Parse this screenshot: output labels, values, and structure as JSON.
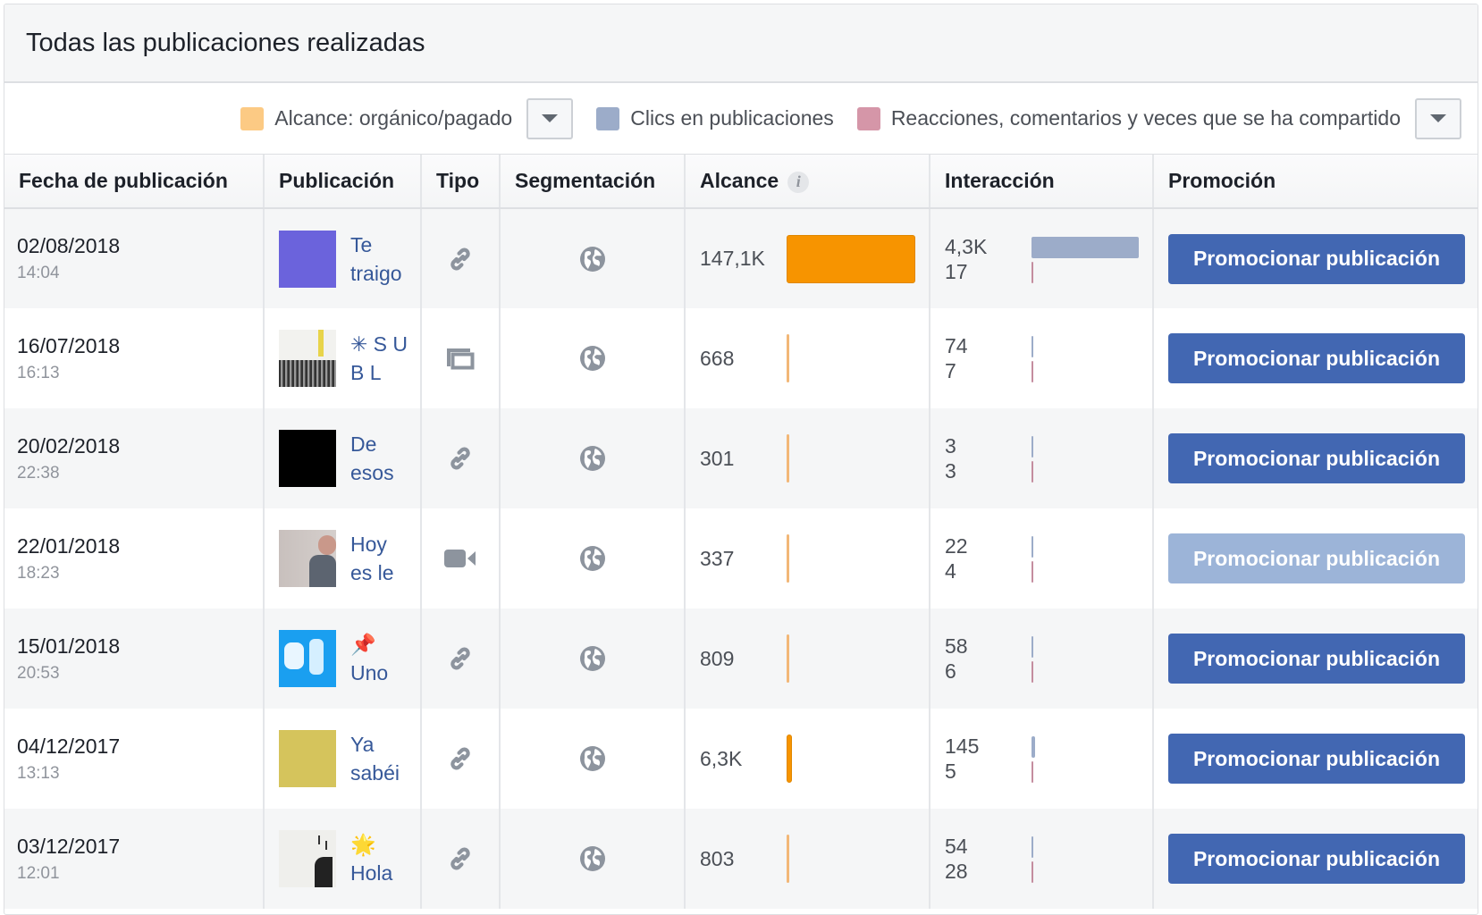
{
  "panel": {
    "title": "Todas las publicaciones realizadas"
  },
  "legend": {
    "items": [
      {
        "label": "Alcance: orgánico/pagado",
        "color": "#fcca84"
      },
      {
        "label": "Clics en publicaciones",
        "color": "#9cacc9"
      },
      {
        "label": "Reacciones, comentarios y veces que se ha compartido",
        "color": "#d596a8"
      }
    ]
  },
  "columns": {
    "date": "Fecha de publicación",
    "publication": "Publicación",
    "type": "Tipo",
    "targeting": "Segmentación",
    "reach": "Alcance",
    "reach_info_icon": "i",
    "interaction": "Interacción",
    "promotion": "Promoción"
  },
  "colors": {
    "reach_bar": "#f79400",
    "clicks_bar": "#9cacc9",
    "reactions_bar": "#c48d9f",
    "promo_button": "#4267b2",
    "promo_button_disabled": "#9cb4d8",
    "link_text": "#365899"
  },
  "rows": [
    {
      "date": "02/08/2018",
      "time": "14:04",
      "thumb": "purple",
      "text": "Te traigo",
      "type_icon": "link-icon",
      "targeting_icon": "globe-icon",
      "reach": "147,1K",
      "reach_value": 147100,
      "clicks": "4,3K",
      "clicks_value": 4300,
      "reactions": "17",
      "reactions_value": 17,
      "promo_label": "Promocionar publicación",
      "promo_enabled": true
    },
    {
      "date": "16/07/2018",
      "time": "16:13",
      "thumb": "crowd",
      "text": "✳ S U B L",
      "type_icon": "album-icon",
      "targeting_icon": "globe-icon",
      "reach": "668",
      "reach_value": 668,
      "clicks": "74",
      "clicks_value": 74,
      "reactions": "7",
      "reactions_value": 7,
      "promo_label": "Promocionar publicación",
      "promo_enabled": true
    },
    {
      "date": "20/02/2018",
      "time": "22:38",
      "thumb": "black",
      "text": "De esos",
      "type_icon": "link-icon",
      "targeting_icon": "globe-icon",
      "reach": "301",
      "reach_value": 301,
      "clicks": "3",
      "clicks_value": 3,
      "reactions": "3",
      "reactions_value": 3,
      "promo_label": "Promocionar publicación",
      "promo_enabled": true
    },
    {
      "date": "22/01/2018",
      "time": "18:23",
      "thumb": "person",
      "text": "Hoy es le",
      "type_icon": "video-icon",
      "targeting_icon": "globe-icon",
      "reach": "337",
      "reach_value": 337,
      "clicks": "22",
      "clicks_value": 22,
      "reactions": "4",
      "reactions_value": 4,
      "promo_label": "Promocionar publicación",
      "promo_enabled": false
    },
    {
      "date": "15/01/2018",
      "time": "20:53",
      "thumb": "blue",
      "text": "📌 Uno",
      "type_icon": "link-icon",
      "targeting_icon": "globe-icon",
      "reach": "809",
      "reach_value": 809,
      "clicks": "58",
      "clicks_value": 58,
      "reactions": "6",
      "reactions_value": 6,
      "promo_label": "Promocionar publicación",
      "promo_enabled": true
    },
    {
      "date": "04/12/2017",
      "time": "13:13",
      "thumb": "mustard",
      "text": "Ya sabéi",
      "type_icon": "link-icon",
      "targeting_icon": "globe-icon",
      "reach": "6,3K",
      "reach_value": 6300,
      "clicks": "145",
      "clicks_value": 145,
      "reactions": "5",
      "reactions_value": 5,
      "promo_label": "Promocionar publicación",
      "promo_enabled": true
    },
    {
      "date": "03/12/2017",
      "time": "12:01",
      "thumb": "sketch",
      "text": "🌟 Hola",
      "type_icon": "link-icon",
      "targeting_icon": "globe-icon",
      "reach": "803",
      "reach_value": 803,
      "clicks": "54",
      "clicks_value": 54,
      "reactions": "28",
      "reactions_value": 28,
      "promo_label": "Promocionar publicación",
      "promo_enabled": true
    }
  ]
}
